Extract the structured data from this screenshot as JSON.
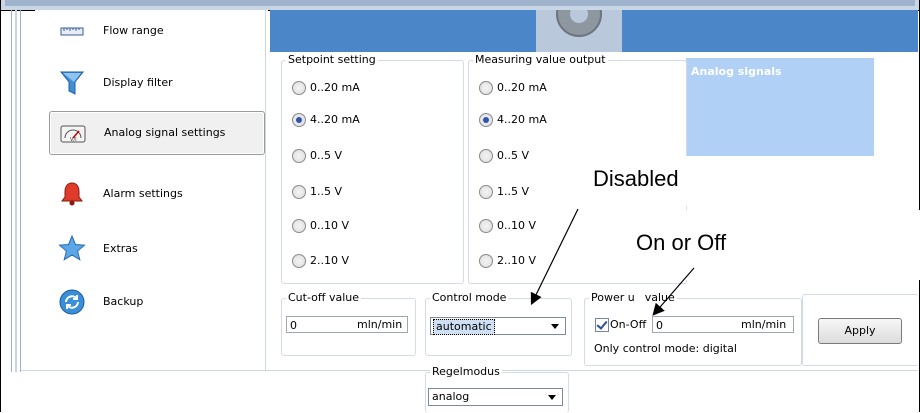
{
  "sidebar": {
    "items": [
      {
        "label": "Flow range",
        "icon": "ruler-icon"
      },
      {
        "label": "Display filter",
        "icon": "funnel-icon"
      },
      {
        "label": "Analog signal settings",
        "icon": "gauge-icon",
        "active": true
      },
      {
        "label": "Alarm settings",
        "icon": "bell-icon"
      },
      {
        "label": "Extras",
        "icon": "star-icon"
      },
      {
        "label": "Backup",
        "icon": "backup-icon"
      }
    ]
  },
  "right_panel": {
    "title": "Analog signals"
  },
  "setpoint": {
    "title": "Setpoint setting",
    "options": [
      "0..20 mA",
      "4..20 mA",
      "0..5  V",
      "1..5 V",
      "0..10  V",
      "2..10 V"
    ],
    "selected": "4..20 mA"
  },
  "measuring": {
    "title": "Measuring value output",
    "options": [
      "0..20 mA",
      "4..20 mA",
      "0..5  V",
      "1..5 V",
      "0..10  V",
      "2..10 V"
    ],
    "selected": "4..20 mA"
  },
  "cutoff": {
    "title": "Cut-off value",
    "value": "0",
    "unit": "mln/min"
  },
  "control_mode": {
    "title": "Control mode",
    "value": "automatic"
  },
  "power_up": {
    "title": "Power u",
    "title_rest": "value",
    "check_label": "On-Off",
    "checked": true,
    "value": "0",
    "unit": "mln/min",
    "note": "Only control mode: digital"
  },
  "apply_label": "Apply",
  "regelmodus": {
    "title": "Regelmodus",
    "value": "analog"
  },
  "annotations": {
    "disabled": "Disabled",
    "on_off": "On or Off"
  },
  "colors": {
    "banner": "#4a86c8",
    "panel": "#b0d0f5"
  }
}
